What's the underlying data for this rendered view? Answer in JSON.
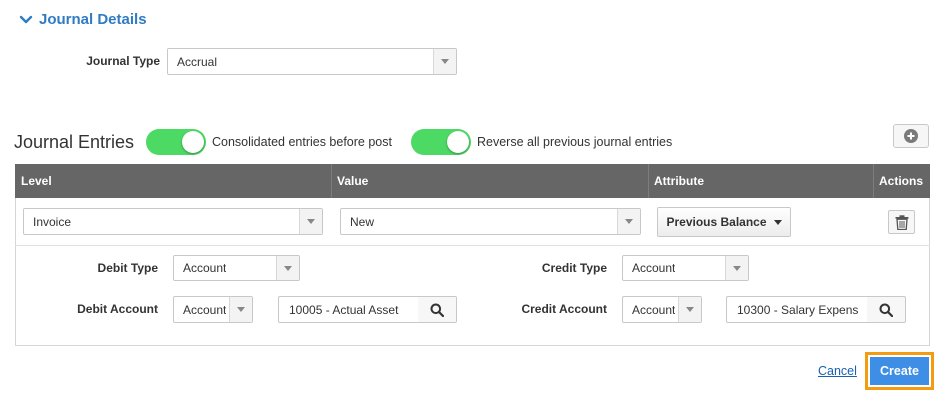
{
  "section": {
    "title": "Journal Details",
    "chevron_icon": "chevron-down-icon"
  },
  "journal_type": {
    "label": "Journal Type",
    "value": "Accrual"
  },
  "journal_entries": {
    "title": "Journal Entries",
    "toggle_consolidated": {
      "label": "Consolidated entries before post",
      "on": true
    },
    "toggle_reverse": {
      "label": "Reverse all previous journal entries",
      "on": true
    },
    "add_icon": "plus-circle-icon"
  },
  "table": {
    "headers": [
      "Level",
      "Value",
      "Attribute",
      "Actions"
    ],
    "row": {
      "level": "Invoice",
      "value": "New",
      "attribute_button": "Previous Balance",
      "delete_icon": "trash-icon"
    }
  },
  "details": {
    "debit_type_label": "Debit Type",
    "debit_type_value": "Account",
    "credit_type_label": "Credit Type",
    "credit_type_value": "Account",
    "debit_account_label": "Debit Account",
    "debit_account_select": "Account",
    "debit_account_value": "10005 - Actual Asset",
    "credit_account_label": "Credit Account",
    "credit_account_select": "Account",
    "credit_account_value": "10300 - Salary Expens",
    "search_icon": "search-icon"
  },
  "footer": {
    "cancel": "Cancel",
    "create": "Create"
  },
  "colors": {
    "accent": "#2f7cc4",
    "toggle_on": "#4cd964",
    "table_header": "#666666",
    "create_button": "#3e8ee6",
    "focus_outline": "#f39c12"
  }
}
